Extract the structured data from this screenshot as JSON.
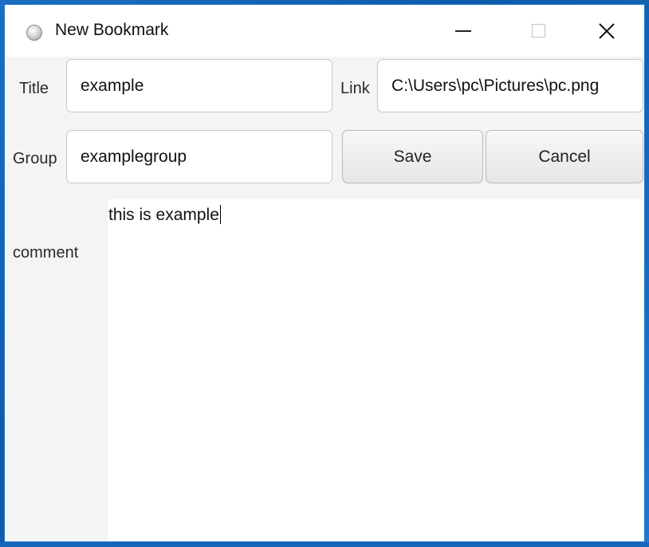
{
  "window": {
    "title": "New Bookmark",
    "icon": "bookmark-app-icon",
    "controls": {
      "minimize": "minimize-icon",
      "maximize": "maximize-icon",
      "close": "close-icon"
    }
  },
  "form": {
    "title_label": "Title",
    "title_value": "example",
    "link_label": "Link",
    "link_value": "C:\\Users\\pc\\Pictures\\pc.png",
    "group_label": "Group",
    "group_value": "examplegroup",
    "save_label": "Save",
    "cancel_label": "Cancel",
    "comment_label": "comment",
    "comment_value": "this is example"
  },
  "colors": {
    "desktop": "#1a6fc2",
    "window_background": "#f4f4f4",
    "field_background": "#ffffff"
  }
}
